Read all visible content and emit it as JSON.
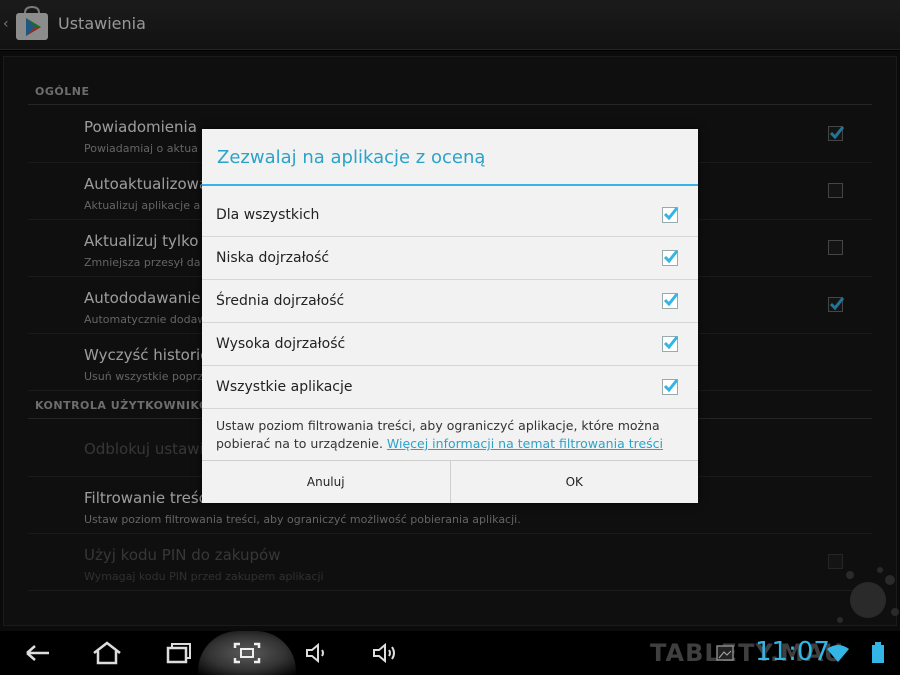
{
  "actionbar": {
    "title": "Ustawienia",
    "app_icon": "play-store-icon"
  },
  "settings": {
    "section_general": "OGÓLNE",
    "section_user": "KONTROLA UŻYTKOWNIKÓW",
    "rows": [
      {
        "title": "Powiadomienia",
        "subtitle": "Powiadamiaj o aktua",
        "checked": true
      },
      {
        "title": "Autoaktualizowa",
        "subtitle": "Aktualizuj aplikacje a",
        "checked": false
      },
      {
        "title": "Aktualizuj tylko n",
        "subtitle": "Zmniejsza przesył da",
        "checked": false
      },
      {
        "title": "Autododawanie w",
        "subtitle": "Automatycznie dodaw",
        "checked": true
      },
      {
        "title": "Wyczyść historię",
        "subtitle": "Usuń wszystkie poprz"
      },
      {
        "title": "Odblokuj ustawi"
      },
      {
        "title": "Filtrowanie treśc",
        "subtitle": "Ustaw poziom filtrowania treści, aby ograniczyć możliwość pobierania aplikacji."
      },
      {
        "title": "Użyj kodu PIN do zakupów",
        "subtitle": "Wymagaj kodu PIN przed zakupem aplikacji",
        "checked": false
      }
    ]
  },
  "dialog": {
    "title": "Zezwalaj na aplikacje z oceną",
    "options": [
      {
        "label": "Dla wszystkich",
        "checked": true
      },
      {
        "label": "Niska dojrzałość",
        "checked": true
      },
      {
        "label": "Średnia dojrzałość",
        "checked": true
      },
      {
        "label": "Wysoka dojrzałość",
        "checked": true
      },
      {
        "label": "Wszystkie aplikacje",
        "checked": true
      }
    ],
    "description": "Ustaw poziom filtrowania treści, aby ograniczyć aplikacje, które można pobierać na to urządzenie.",
    "link": "Więcej informacji na temat filtrowania treści",
    "cancel_label": "Anuluj",
    "ok_label": "OK"
  },
  "statusbar": {
    "watermark": "TABLETY.MAU",
    "clock": "11:07"
  },
  "colors": {
    "accent": "#33b5e5",
    "dialog_bg": "#f2f2f2",
    "background": "#181818"
  }
}
